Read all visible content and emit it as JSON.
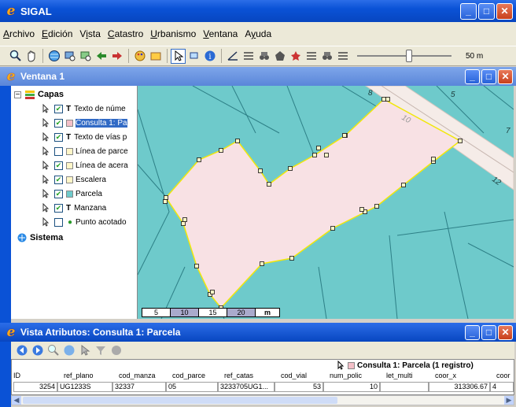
{
  "app": {
    "title": "SIGAL"
  },
  "menu": [
    {
      "key": "A",
      "rest": "rchivo"
    },
    {
      "key": "E",
      "rest": "dición"
    },
    {
      "pre": "V",
      "key": "i",
      "rest": "sta"
    },
    {
      "key": "C",
      "rest": "atastro"
    },
    {
      "key": "U",
      "rest": "rbanismo"
    },
    {
      "key": "V",
      "rest": "entana"
    },
    {
      "pre": "A",
      "key": "y",
      "rest": "uda"
    }
  ],
  "toolbar": {
    "scale_value": "50 m",
    "zoom_level": 0.55
  },
  "map_window": {
    "title": "Ventana 1"
  },
  "layers": {
    "group": "Capas",
    "items": [
      {
        "label": "Texto de núme",
        "checked": true,
        "type": "T",
        "selected": false
      },
      {
        "label": "Consulta 1: Pa",
        "checked": true,
        "type": "fill",
        "color": "#f4c0c8",
        "selected": true
      },
      {
        "label": "Texto de vías p",
        "checked": true,
        "type": "T",
        "selected": false
      },
      {
        "label": "Línea de parce",
        "checked": false,
        "type": "fill",
        "color": "#fff6c8",
        "selected": false
      },
      {
        "label": "Línea de acera",
        "checked": true,
        "type": "fill",
        "color": "#fff6c8",
        "selected": false
      },
      {
        "label": "Escalera",
        "checked": true,
        "type": "fill",
        "color": "#fff6c8",
        "selected": false
      },
      {
        "label": "Parcela",
        "checked": true,
        "type": "fill",
        "color": "#6ecacb",
        "selected": false
      },
      {
        "label": "Manzana",
        "checked": true,
        "type": "T",
        "selected": false
      },
      {
        "label": "Punto acotado",
        "checked": false,
        "type": "dot",
        "selected": false
      }
    ],
    "system": "Sistema"
  },
  "map": {
    "labels": [
      "8",
      "5",
      "10",
      "7",
      "12"
    ],
    "scalebar": [
      "5",
      "10",
      "15",
      "20",
      "m"
    ]
  },
  "attr_window": {
    "title": "Vista Atributos: Consulta 1: Parcela"
  },
  "query": {
    "title": "Consulta 1: Parcela (1 registro)"
  },
  "table": {
    "headers": [
      "ID",
      "ref_plano",
      "cod_manza",
      "cod_parce",
      "ref_catas",
      "cod_vial",
      "num_polic",
      "let_multi",
      "coor_x",
      "coor"
    ],
    "row": [
      "3254",
      "UG1233S",
      "32337",
      "05",
      "3233705UG1...",
      "53",
      "10",
      "",
      "313306.67",
      "4"
    ]
  }
}
